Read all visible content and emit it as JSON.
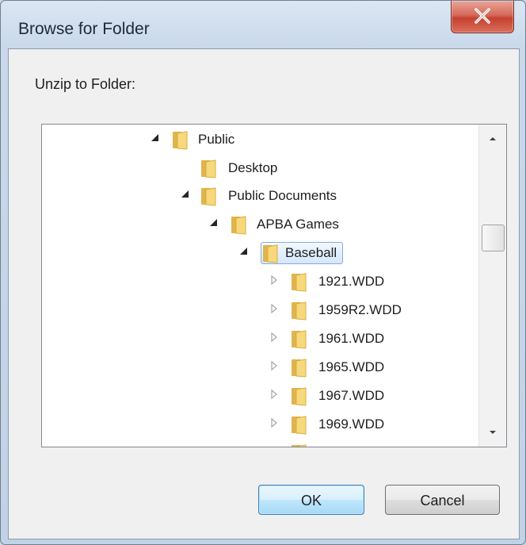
{
  "window": {
    "title": "Browse for Folder"
  },
  "dialog": {
    "prompt": "Unzip to Folder:"
  },
  "tree": {
    "nodes": [
      {
        "label": "Public",
        "expander": "expanded"
      },
      {
        "label": "Desktop",
        "expander": "none"
      },
      {
        "label": "Public Documents",
        "expander": "expanded"
      },
      {
        "label": "APBA Games",
        "expander": "expanded"
      },
      {
        "label": "Baseball",
        "expander": "expanded",
        "selected": true
      },
      {
        "label": "1921.WDD",
        "expander": "collapsed"
      },
      {
        "label": "1959R2.WDD",
        "expander": "collapsed"
      },
      {
        "label": "1961.WDD",
        "expander": "collapsed"
      },
      {
        "label": "1965.WDD",
        "expander": "collapsed"
      },
      {
        "label": "1967.WDD",
        "expander": "collapsed"
      },
      {
        "label": "1969.WDD",
        "expander": "collapsed"
      }
    ]
  },
  "buttons": {
    "ok": "OK",
    "cancel": "Cancel"
  },
  "icons": {
    "close": "close-icon",
    "folder": "folder-icon",
    "expanded": "expanded-arrow-icon",
    "collapsed": "collapsed-arrow-icon",
    "scroll_up": "scroll-up-arrow-icon",
    "scroll_down": "scroll-down-arrow-icon"
  },
  "colors": {
    "selection_border": "#84acdd",
    "close_button": "#c5412f",
    "window_frame": "#c9d8ea"
  }
}
